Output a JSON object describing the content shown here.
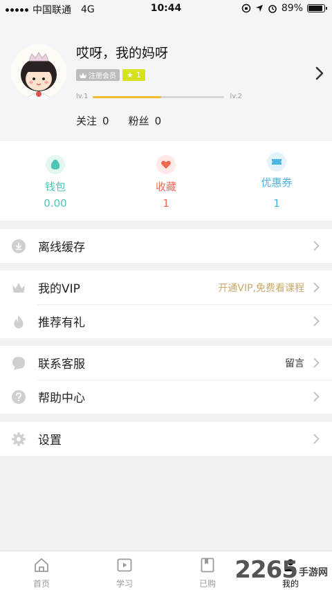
{
  "status_bar": {
    "carrier": "中国联通",
    "network": "4G",
    "time": "10:44",
    "battery": "89%",
    "battery_level": 0.89
  },
  "profile": {
    "username": "哎呀，我的妈呀",
    "member_badge": "注册会员",
    "level_badge": "1",
    "level_start": "lv.1",
    "level_end": "lv.2",
    "level_progress": 0.52,
    "following_label": "关注",
    "following_count": "0",
    "fans_label": "粉丝",
    "fans_count": "0"
  },
  "stats": [
    {
      "label": "钱包",
      "value": "0.00",
      "icon": "wallet-icon",
      "color": "#4dc6b5"
    },
    {
      "label": "收藏",
      "value": "1",
      "icon": "heart-icon",
      "color": "#ee6a55"
    },
    {
      "label": "优惠券",
      "value": "1",
      "icon": "coupon-icon",
      "color": "#4ab6e0"
    }
  ],
  "menu": {
    "offline_cache": {
      "label": "离线缓存",
      "icon": "download-icon"
    },
    "my_vip": {
      "label": "我的VIP",
      "hint": "开通VIP,免费看课程",
      "icon": "crown-icon"
    },
    "referral": {
      "label": "推荐有礼",
      "icon": "flame-icon"
    },
    "customer_service": {
      "label": "联系客服",
      "hint": "留言",
      "icon": "chat-icon"
    },
    "help_center": {
      "label": "帮助中心",
      "icon": "help-icon"
    },
    "settings": {
      "label": "设置",
      "icon": "gear-icon"
    }
  },
  "colors": {
    "vip_hint": "#c9a86a",
    "level_fill": "#f2b92c",
    "level_badge": "#d6e21f"
  },
  "tabs": [
    {
      "label": "首页",
      "icon": "home-icon"
    },
    {
      "label": "学习",
      "icon": "play-icon"
    },
    {
      "label": "已购",
      "icon": "bookmark-icon"
    },
    {
      "label": "我的",
      "icon": "user-icon"
    }
  ],
  "watermark": {
    "number": "2265",
    "text": "手游网"
  }
}
